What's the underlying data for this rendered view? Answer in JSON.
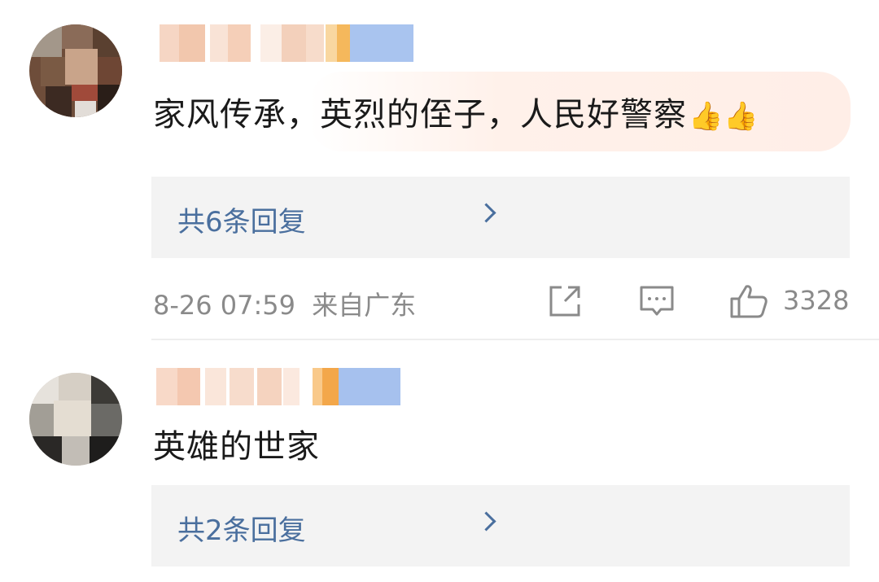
{
  "comments": [
    {
      "text": "家风传承，英烈的侄子，人民好警察",
      "emoji": "👍👍",
      "replies_label": "共6条回复",
      "time": "8-26 07:59",
      "location": "来自广东",
      "likes": "3328"
    },
    {
      "text": "英雄的世家",
      "replies_label": "共2条回复"
    }
  ],
  "icons": {
    "share": "share-icon",
    "comment": "comment-icon",
    "like": "thumbs-up-icon",
    "chevron": "chevron-right-icon"
  },
  "colors": {
    "reply_link": "#4a6f9e",
    "meta_text": "#8a8a8a",
    "reply_bg": "#f3f3f3",
    "highlight": "#ffeee7"
  }
}
